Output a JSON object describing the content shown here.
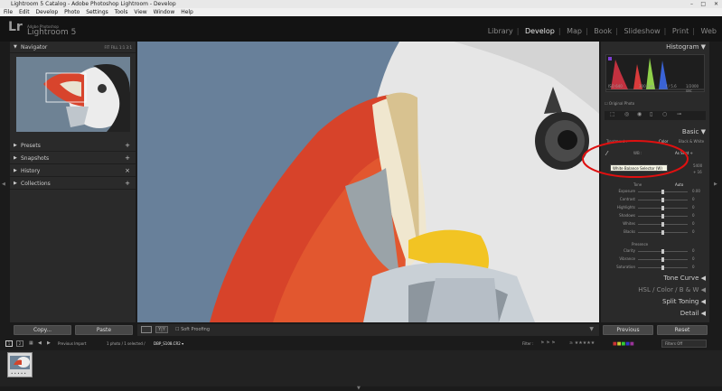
{
  "window": {
    "title": "Lightroom 5 Catalog - Adobe Photoshop Lightroom - Develop",
    "controls": [
      "–",
      "□",
      "✕"
    ]
  },
  "menubar": [
    "File",
    "Edit",
    "Develop",
    "Photo",
    "Settings",
    "Tools",
    "View",
    "Window",
    "Help"
  ],
  "identity": {
    "logo": "Lr",
    "brand": "Adobe Photoshop",
    "product": "Lightroom 5"
  },
  "modules": [
    "Library",
    "Develop",
    "Map",
    "Book",
    "Slideshow",
    "Print",
    "Web"
  ],
  "active_module": "Develop",
  "left_panel": {
    "navigator": {
      "title": "Navigator",
      "zoom": "FIT  FILL  1:1  3:1"
    },
    "sections": [
      "Presets",
      "Snapshots",
      "History",
      "Collections"
    ]
  },
  "right_panel": {
    "histogram_title": "Histogram",
    "histogram_info": {
      "iso": "ISO 640",
      "focal": "300 mm",
      "aperture": "f / 5.6",
      "shutter": "1/2000 sec"
    },
    "original_photo": "Original Photo",
    "basic_title": "Basic",
    "treatment": {
      "label": "Treatment :",
      "color": "Color",
      "bw": "Black & White"
    },
    "wb": {
      "label": "WB :",
      "value": "As Shot ÷"
    },
    "tooltip": "White Balance Selector (W)",
    "temp_val": "5400",
    "tint_val": "+ 16",
    "tone": {
      "label": "Tone",
      "auto": "Auto"
    },
    "sliders": [
      {
        "label": "Exposure",
        "value": "0.00",
        "pos": 0.5
      },
      {
        "label": "Contrast",
        "value": "0",
        "pos": 0.5
      },
      {
        "label": "Highlights",
        "value": "0",
        "pos": 0.5
      },
      {
        "label": "Shadows",
        "value": "0",
        "pos": 0.5
      },
      {
        "label": "Whites",
        "value": "0",
        "pos": 0.5
      },
      {
        "label": "Blacks",
        "value": "0",
        "pos": 0.5
      }
    ],
    "presence": {
      "label": "Presence"
    },
    "presence_sliders": [
      {
        "label": "Clarity",
        "value": "0",
        "pos": 0.5
      },
      {
        "label": "Vibrance",
        "value": "0",
        "pos": 0.5
      },
      {
        "label": "Saturation",
        "value": "0",
        "pos": 0.5
      }
    ],
    "collapsed": [
      "Tone Curve",
      "HSL / Color / B & W",
      "Split Toning",
      "Detail"
    ]
  },
  "toolbar": {
    "soft_proofing": "Soft Proofing"
  },
  "left_buttons": {
    "copy": "Copy...",
    "paste": "Paste"
  },
  "right_buttons": {
    "previous": "Previous",
    "reset": "Reset"
  },
  "filmstrip": {
    "pages": [
      "1",
      "2"
    ],
    "source": "Previous Import",
    "count": "1 photo / 1 selected /",
    "filename": "DBP_S108.CR2",
    "filter_label": "Filter :",
    "filters_off": "Filters Off",
    "thumb_stars": "• • • • •"
  }
}
